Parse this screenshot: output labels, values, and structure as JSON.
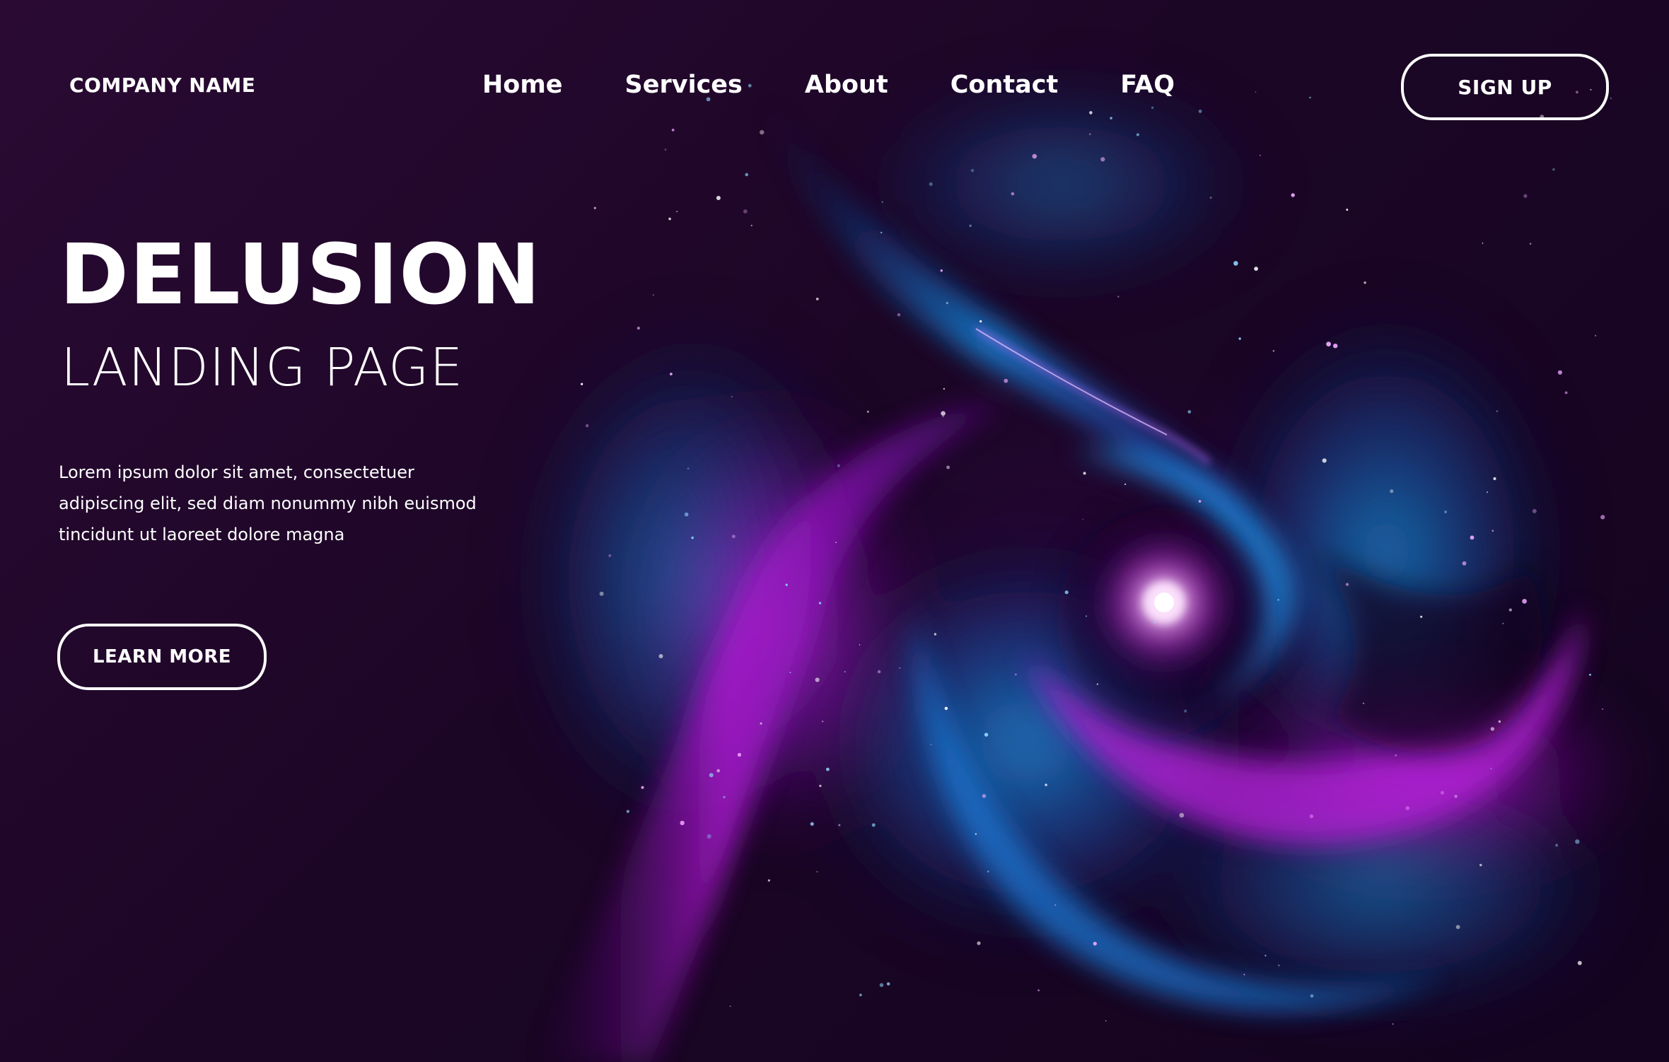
{
  "header": {
    "brand": "COMPANY NAME",
    "nav": [
      "Home",
      "Services",
      "About",
      "Contact",
      "FAQ"
    ],
    "signup_label": "SIGN UP"
  },
  "hero": {
    "title": "DELUSION",
    "subtitle": "LANDING PAGE",
    "body": "Lorem ipsum dolor sit amet, consectetuer adipiscing elit, sed diam nonummy nibh euismod tincidunt ut laoreet dolore magna",
    "cta_label": "LEARN MORE"
  },
  "colors": {
    "background": "#1c0626",
    "magenta": "#b21fd6",
    "blue": "#1e8fe0",
    "text": "#ffffff"
  }
}
